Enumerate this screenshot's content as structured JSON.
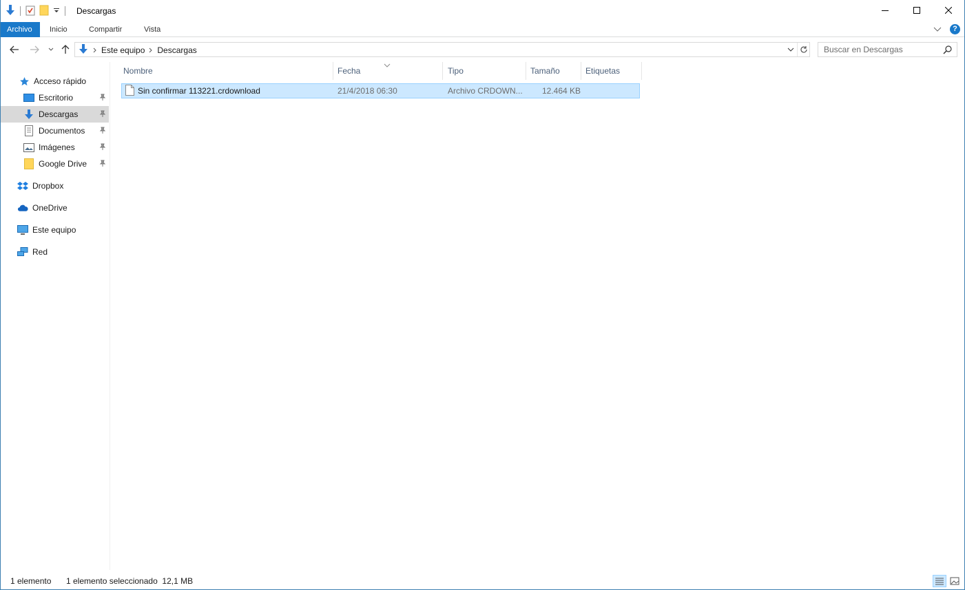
{
  "window": {
    "title": "Descargas"
  },
  "ribbon": {
    "tabs": [
      "Archivo",
      "Inicio",
      "Compartir",
      "Vista"
    ],
    "help": "?"
  },
  "address": {
    "crumbs": [
      "Este equipo",
      "Descargas"
    ]
  },
  "search": {
    "placeholder": "Buscar en Descargas"
  },
  "navpane": {
    "quick_access": "Acceso rápido",
    "pinned": [
      "Escritorio",
      "Descargas",
      "Documentos",
      "Imágenes",
      "Google Drive"
    ],
    "locations": [
      "Dropbox",
      "OneDrive",
      "Este equipo",
      "Red"
    ]
  },
  "columns": [
    "Nombre",
    "Fecha",
    "Tipo",
    "Tamaño",
    "Etiquetas"
  ],
  "files": [
    {
      "name": "Sin confirmar 113221.crdownload",
      "date": "21/4/2018 06:30",
      "type": "Archivo CRDOWN...",
      "size": "12.464 KB",
      "tags": "",
      "selected": true
    }
  ],
  "status": {
    "count": "1 elemento",
    "selection": "1 elemento seleccionado  12,1 MB"
  },
  "colors": {
    "accent": "#1979ca",
    "selection_bg": "#cce8ff",
    "selection_border": "#99d1ff",
    "folder_yellow": "#ffd65b"
  }
}
